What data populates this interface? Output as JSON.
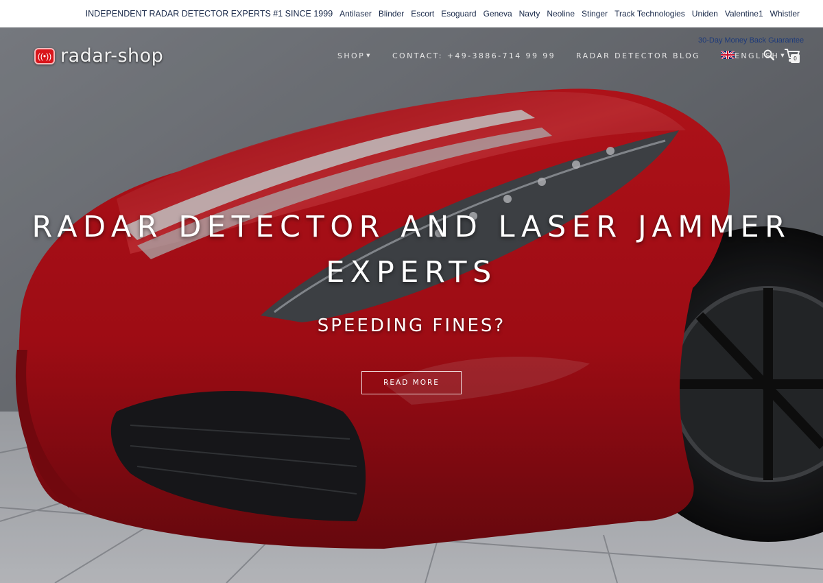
{
  "topbar": {
    "tagline": "INDEPENDENT RADAR DETECTOR EXPERTS #1 SINCE 1999",
    "brands": [
      "Antilaser",
      "Blinder",
      "Escort",
      "Esoguard",
      "Geneva",
      "Navty",
      "Neoline",
      "Stinger",
      "Track Technologies",
      "Uniden",
      "Valentine1",
      "Whistler"
    ]
  },
  "header": {
    "logo_text": "radar-shop",
    "guarantee": "30-Day Money Back Guarantee",
    "nav": {
      "shop": "SHOP",
      "contact": "CONTACT: +49-3886-714 99 99",
      "blog": "RADAR DETECTOR BLOG",
      "language": "ENGLISH"
    },
    "cart_count": "0"
  },
  "hero": {
    "headline_line1": "RADAR DETECTOR AND LASER JAMMER",
    "headline_line2": "EXPERTS",
    "subheadline": "SPEEDING FINES?",
    "cta_label": "READ MORE"
  },
  "colors": {
    "brand_red": "#d9151b",
    "nav_text": "#e7e7e7",
    "topbar_text": "#1a2a4a",
    "car_red": "#c4121c"
  },
  "icons": {
    "logo": "radar-icon",
    "search": "search-icon",
    "cart": "cart-icon",
    "language": "uk-flag-icon"
  }
}
